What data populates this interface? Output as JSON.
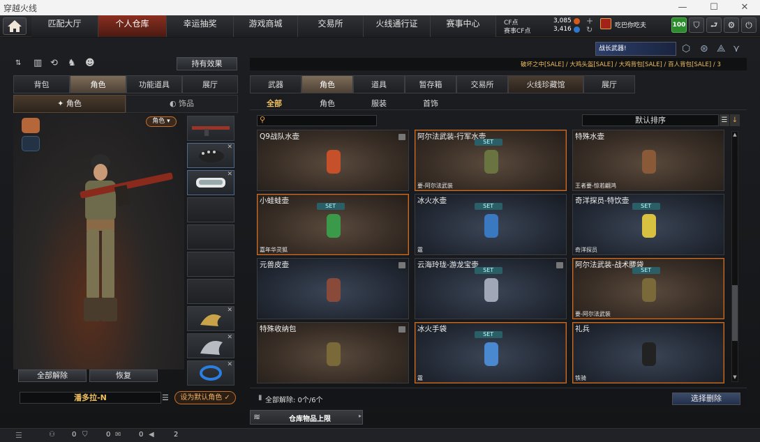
{
  "window": {
    "title": "穿越火线"
  },
  "nav": {
    "tabs": [
      "匹配大厅",
      "个人仓库",
      "幸运抽奖",
      "游戏商城",
      "交易所",
      "火线通行证",
      "赛事中心"
    ],
    "cf_label": "CF点",
    "cf_value": "3,085",
    "match_cf_label": "赛事CF点",
    "match_cf_value": "3,416",
    "username": "吃巴你吃夫",
    "level": "100"
  },
  "left": {
    "effect_button": "持有效果",
    "tabs": [
      "背包",
      "角色",
      "功能道具",
      "展厅"
    ],
    "subtabs": [
      "角色",
      "饰品"
    ],
    "role_badge": "角色",
    "release_all": "全部解除",
    "restore": "恢复",
    "character_name": "潘多拉-N",
    "set_default": "设为默认角色"
  },
  "right": {
    "banner_text": "战长武器!",
    "marquee": "破坏之中[SALE] / 大鸡头盔[SALE] / 大鸡背包[SALE] / 百人背包[SALE] / 3",
    "tabs": [
      "武器",
      "角色",
      "道具",
      "暂存箱",
      "交易所",
      "火线珍藏馆",
      "展厅"
    ],
    "subtabs": [
      "全部",
      "角色",
      "服装",
      "首饰"
    ],
    "sort_label": "默认排序",
    "items": [
      {
        "name": "Q9战队水壶",
        "set": "",
        "footer": "",
        "style": "brown",
        "sel": false,
        "lock": true,
        "icon": "orange-flask-icon"
      },
      {
        "name": "阿尔法武装-行军水壶",
        "set": "SET",
        "footer": "要-阿尔法武装",
        "style": "brown",
        "sel": true,
        "lock": false,
        "icon": "army-canteen-icon"
      },
      {
        "name": "特殊水壶",
        "set": "",
        "footer": "王者要-惊若翩鸿",
        "style": "brown",
        "sel": false,
        "lock": false,
        "icon": "brown-flask-icon"
      },
      {
        "name": "小蛙蛙壶",
        "set": "SET",
        "footer": "嘉年华灵狐",
        "style": "brown",
        "sel": true,
        "lock": false,
        "icon": "frog-pot-icon"
      },
      {
        "name": "冰火水壶",
        "set": "SET",
        "footer": "霆",
        "style": "blue",
        "sel": false,
        "lock": false,
        "icon": "ice-fire-bottle-icon"
      },
      {
        "name": "奇洋探员-特饮壶",
        "set": "SET",
        "footer": "奇洋探员",
        "style": "blue",
        "sel": false,
        "lock": false,
        "icon": "coconut-drink-icon"
      },
      {
        "name": "元兽皮壶",
        "set": "",
        "footer": "",
        "style": "blue",
        "sel": false,
        "lock": true,
        "icon": "beast-skin-pot-icon"
      },
      {
        "name": "云海玲珑-游龙宝壶",
        "set": "SET",
        "footer": "",
        "style": "blue",
        "sel": false,
        "lock": true,
        "icon": "dragon-pot-icon"
      },
      {
        "name": "阿尔法武装-战术腰袋",
        "set": "SET",
        "footer": "要-阿尔法武装",
        "style": "brown",
        "sel": true,
        "lock": false,
        "icon": "tactical-pouch-icon"
      },
      {
        "name": "特殊收纳包",
        "set": "",
        "footer": "",
        "style": "brown",
        "sel": false,
        "lock": true,
        "icon": "storage-pouch-icon"
      },
      {
        "name": "冰火手袋",
        "set": "SET",
        "footer": "霆",
        "style": "blue",
        "sel": true,
        "lock": false,
        "icon": "ice-fire-bag-icon"
      },
      {
        "name": "礼兵",
        "set": "",
        "footer": "铁骑",
        "style": "blue",
        "sel": true,
        "lock": false,
        "icon": "baton-icon"
      }
    ],
    "release_count": "全部解除: 0个/6个",
    "select_release": "选择删除",
    "storage_limit": "仓库物品上限"
  },
  "status": {
    "counts": [
      "0",
      "0",
      "0",
      "2"
    ]
  },
  "colors": {
    "accent": "#c8702a",
    "active_tab": "#8b2f20"
  }
}
